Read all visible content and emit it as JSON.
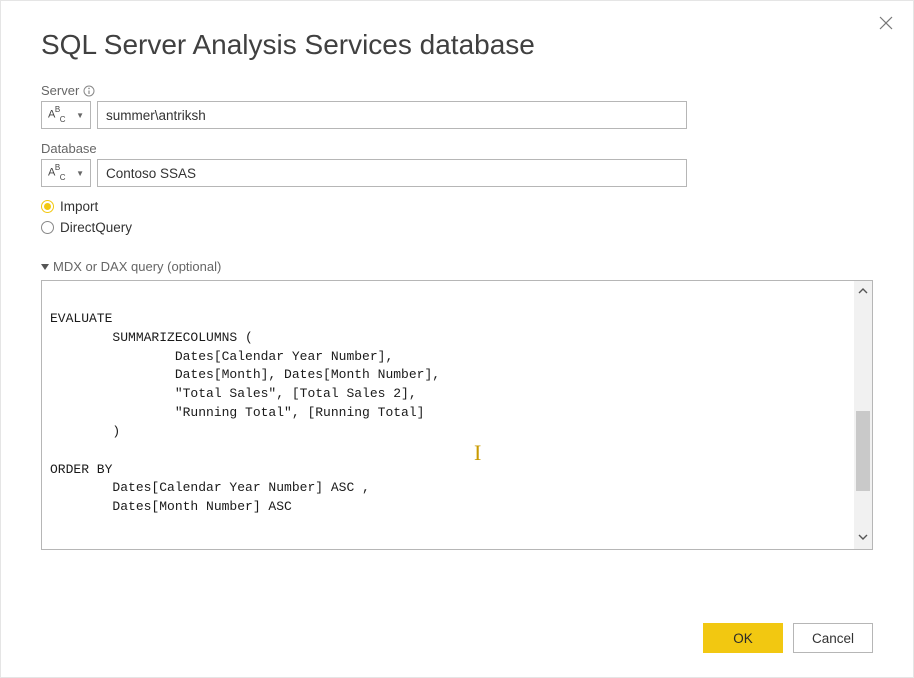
{
  "dialog": {
    "title": "SQL Server Analysis Services database"
  },
  "fields": {
    "server_label": "Server",
    "server_value": "summer\\antriksh",
    "database_label": "Database",
    "database_value": "Contoso SSAS",
    "type_selector_text": "ABC"
  },
  "mode": {
    "import_label": "Import",
    "directquery_label": "DirectQuery",
    "selected": "Import"
  },
  "query": {
    "header": "MDX or DAX query (optional)",
    "text": "\nEVALUATE\n        SUMMARIZECOLUMNS (\n                Dates[Calendar Year Number],\n                Dates[Month], Dates[Month Number],\n                \"Total Sales\", [Total Sales 2],\n                \"Running Total\", [Running Total]\n        )\n\nORDER BY\n        Dates[Calendar Year Number] ASC ,\n        Dates[Month Number] ASC"
  },
  "buttons": {
    "ok": "OK",
    "cancel": "Cancel"
  }
}
